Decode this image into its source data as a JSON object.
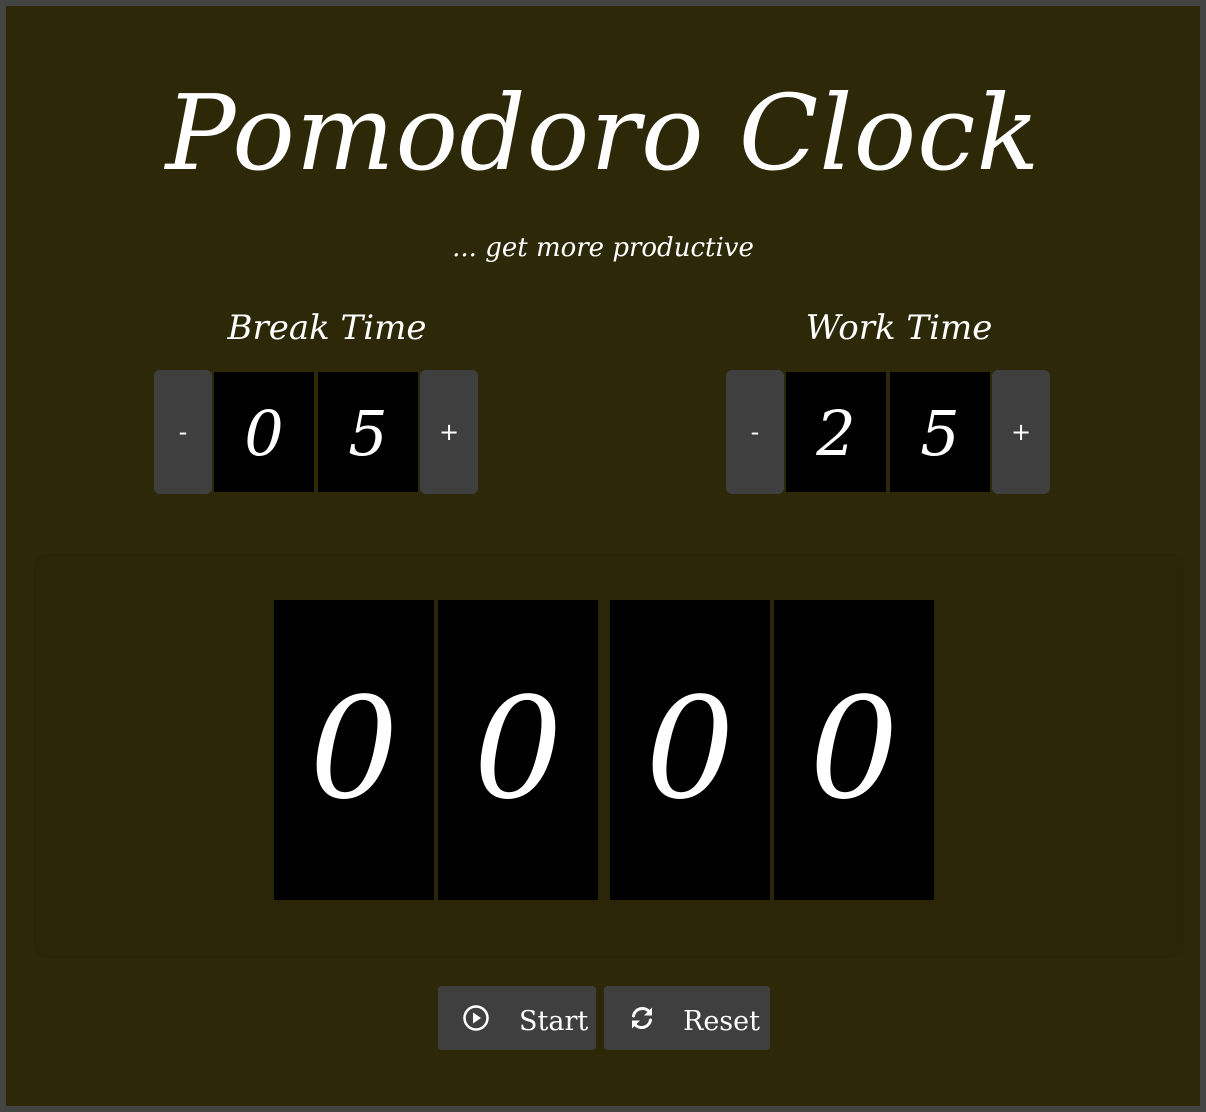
{
  "app": {
    "title": "Pomodoro Clock",
    "subtitle": "... get more productive"
  },
  "break_setter": {
    "label": "Break Time",
    "decrement_label": "-",
    "increment_label": "+",
    "digits": [
      "0",
      "5"
    ]
  },
  "work_setter": {
    "label": "Work Time",
    "decrement_label": "-",
    "increment_label": "+",
    "digits": [
      "2",
      "5"
    ]
  },
  "timer": {
    "digits": [
      "0",
      "0",
      "0",
      "0"
    ]
  },
  "controls": {
    "start": {
      "label": "Start",
      "icon": "play-circle-icon"
    },
    "reset": {
      "label": "Reset",
      "icon": "refresh-icon"
    }
  },
  "colors": {
    "background": "#2d2808",
    "frame": "#444444",
    "button": "#3f3f3f",
    "digit_tile": "#000000",
    "text": "#ffffff"
  }
}
